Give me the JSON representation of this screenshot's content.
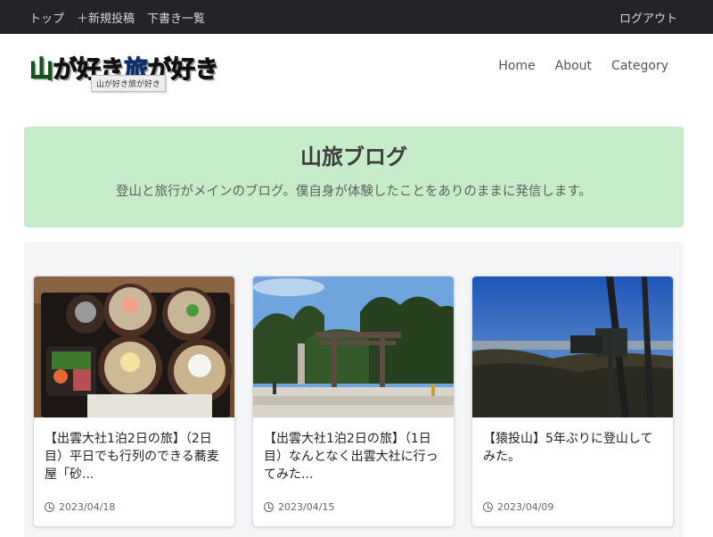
{
  "admin_bar": {
    "links": [
      "トップ",
      "＋新規投稿",
      "下書き一覧"
    ],
    "logout": "ログアウト"
  },
  "header": {
    "logo": {
      "part1_green": "山",
      "part2": "が好き",
      "part3_blue": "旅",
      "part4": "が好き"
    },
    "tooltip": "山が好き旅が好き",
    "nav": [
      "Home",
      "About",
      "Category"
    ]
  },
  "hero": {
    "title": "山旅ブログ",
    "subtitle": "登山と旅行がメインのブログ。僕自身が体験したことをありのままに発信します。"
  },
  "posts": [
    {
      "title": "【出雲大社1泊2日の旅】（2日目）平日でも行列のできる蕎麦屋「砂...",
      "date": "2023/04/18",
      "image": "soba-tray-photo"
    },
    {
      "title": "【出雲大社1泊2日の旅】（1日目）なんとなく出雲大社に行ってみた...",
      "date": "2023/04/15",
      "image": "torii-gate-photo"
    },
    {
      "title": "【猿投山】5年ぶりに登山してみた。",
      "date": "2023/04/09",
      "image": "mountain-sign-photo"
    }
  ]
}
